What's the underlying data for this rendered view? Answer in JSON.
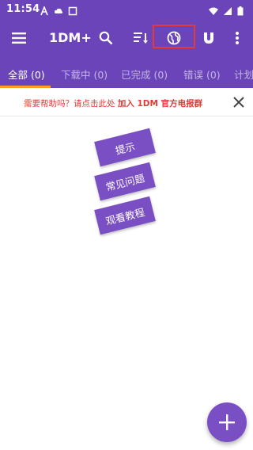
{
  "status_bar": {
    "time": "11:54",
    "icons_left": [
      "font-a-icon",
      "cloud-icon",
      "square-icon"
    ],
    "icons_right": [
      "wifi-icon",
      "signal-icon",
      "battery-icon"
    ]
  },
  "toolbar": {
    "title": "1DM+",
    "actions": [
      "menu-icon",
      "search-icon",
      "sort-icon",
      "browser-globe-icon",
      "magnet-icon",
      "more-vert-icon"
    ],
    "highlight_color": "#e53935"
  },
  "tabs": [
    {
      "label": "全部 (0)",
      "active": true
    },
    {
      "label": "下载中 (0)",
      "active": false
    },
    {
      "label": "已完成 (0)",
      "active": false
    },
    {
      "label": "错误 (0)",
      "active": false
    },
    {
      "label": "计划",
      "active": false
    }
  ],
  "banner": {
    "text": "需要帮助吗？请点击此处 ",
    "link": "加入 1DM 官方电报群"
  },
  "tips": [
    "提示",
    "常见问题",
    "观看教程"
  ],
  "colors": {
    "primary": "#6a44b8",
    "accent": "#7b4fc4",
    "tab_indicator": "#ff9f1c",
    "banner_text": "#e53935"
  }
}
